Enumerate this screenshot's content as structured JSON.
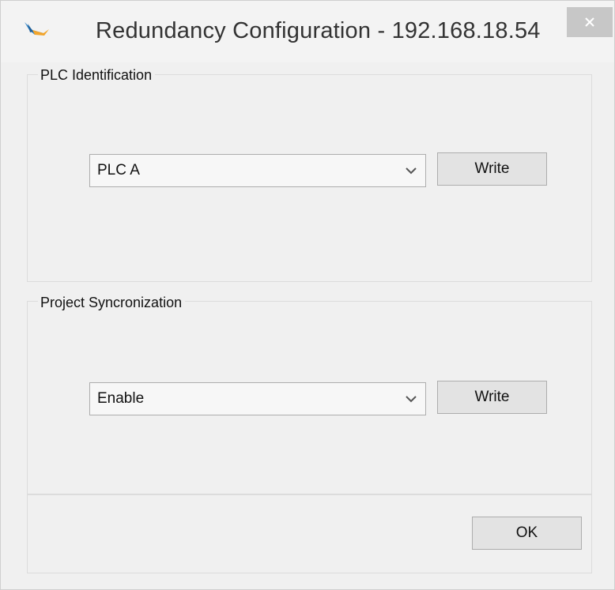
{
  "window": {
    "title": "Redundancy Configuration - 192.168.18.54",
    "close_icon": "close-icon",
    "app_icon": "bird-logo-icon"
  },
  "plc_identification": {
    "legend": "PLC Identification",
    "selected_value": "PLC A",
    "dropdown_icon": "chevron-down-icon",
    "write_label": "Write"
  },
  "project_sync": {
    "legend": "Project Syncronization",
    "selected_value": "Enable",
    "dropdown_icon": "chevron-down-icon",
    "write_label": "Write"
  },
  "footer": {
    "ok_label": "OK"
  },
  "colors": {
    "window_bg": "#f0f0f0",
    "close_button_bg": "#c7c7c7",
    "button_bg": "#e3e3e3",
    "border": "#adadad"
  }
}
